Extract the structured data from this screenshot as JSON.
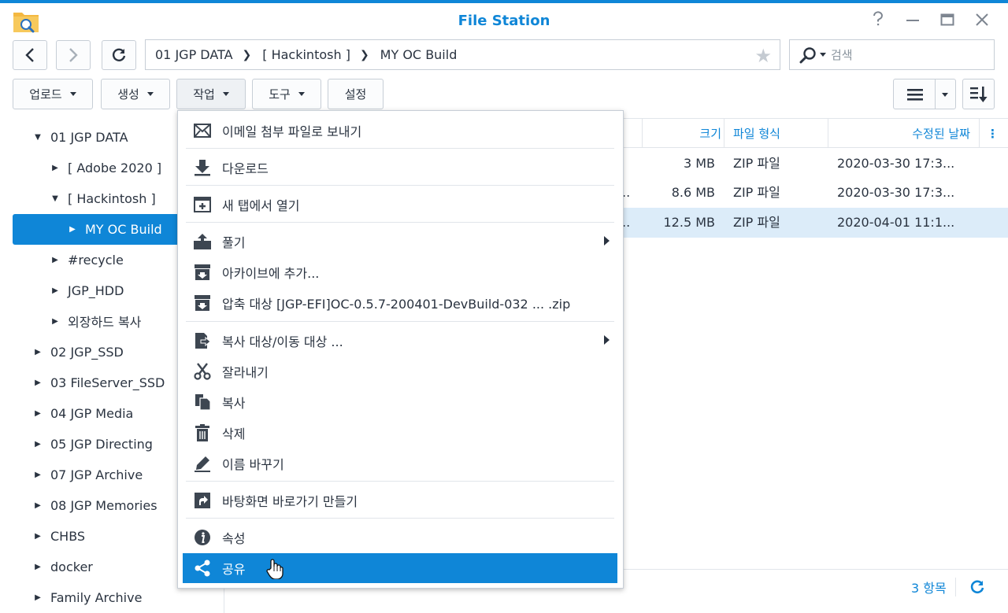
{
  "window": {
    "title": "File Station"
  },
  "nav": {
    "path": [
      "01 JGP DATA",
      "[ Hackintosh ]",
      "MY OC Build"
    ],
    "search_placeholder": "검색"
  },
  "toolbar": {
    "upload": "업로드",
    "create": "생성",
    "action": "작업",
    "tools": "도구",
    "settings": "설정"
  },
  "tree": {
    "items": [
      {
        "label": "01 JGP DATA",
        "state": "expanded"
      },
      {
        "label": "[ Adobe 2020 ]",
        "state": "collapsed"
      },
      {
        "label": "[ Hackintosh ]",
        "state": "expanded"
      },
      {
        "label": "MY OC Build",
        "state": "collapsed"
      },
      {
        "label": "#recycle",
        "state": "collapsed"
      },
      {
        "label": "JGP_HDD",
        "state": "collapsed"
      },
      {
        "label": "외장하드 복사",
        "state": "collapsed"
      },
      {
        "label": "02 JGP_SSD",
        "state": "collapsed"
      },
      {
        "label": "03 FileServer_SSD",
        "state": "collapsed"
      },
      {
        "label": "04 JGP Media",
        "state": "collapsed"
      },
      {
        "label": "05 JGP Directing",
        "state": "collapsed"
      },
      {
        "label": "07 JGP Archive",
        "state": "collapsed"
      },
      {
        "label": "08 JGP Memories",
        "state": "collapsed"
      },
      {
        "label": "CHBS",
        "state": "collapsed"
      },
      {
        "label": "docker",
        "state": "collapsed"
      },
      {
        "label": "Family Archive",
        "state": "collapsed"
      }
    ]
  },
  "file_list": {
    "headers": {
      "size": "크기",
      "type": "파일 형식",
      "modified": "수정된 날짜"
    },
    "rows": [
      {
        "name_tail": "",
        "size": "3 MB",
        "type": "ZIP 파일",
        "modified": "2020-03-30 17:3..."
      },
      {
        "name_tail": "..",
        "size": "8.6 MB",
        "type": "ZIP 파일",
        "modified": "2020-03-30 17:3..."
      },
      {
        "name_tail": "..",
        "size": "12.5 MB",
        "type": "ZIP 파일",
        "modified": "2020-04-01 11:1..."
      }
    ],
    "count": "3 항목"
  },
  "context_menu": {
    "items": [
      {
        "label": "이메일 첨부 파일로 보내기",
        "icon": "mail-icon"
      },
      {
        "label": "다운로드",
        "icon": "download-icon"
      },
      {
        "label": "새 탭에서 열기",
        "icon": "new-tab-icon"
      },
      {
        "label": "풀기",
        "icon": "extract-icon",
        "submenu": true
      },
      {
        "label": "아카이브에 추가...",
        "icon": "archive-icon"
      },
      {
        "label": "압축 대상 [JGP-EFI]OC-0.5.7-200401-DevBuild-032 ... .zip",
        "icon": "compress-icon"
      },
      {
        "label": "복사 대상/이동 대상 ...",
        "icon": "copy-move-icon",
        "submenu": true
      },
      {
        "label": "잘라내기",
        "icon": "scissors-icon"
      },
      {
        "label": "복사",
        "icon": "copy-icon"
      },
      {
        "label": "삭제",
        "icon": "trash-icon"
      },
      {
        "label": "이름 바꾸기",
        "icon": "pencil-icon"
      },
      {
        "label": "바탕화면 바로가기 만들기",
        "icon": "shortcut-icon"
      },
      {
        "label": "속성",
        "icon": "info-icon"
      },
      {
        "label": "공유",
        "icon": "share-icon",
        "highlighted": true
      }
    ]
  },
  "colors": {
    "accent": "#0f86d7",
    "selection": "#dcecf9"
  }
}
